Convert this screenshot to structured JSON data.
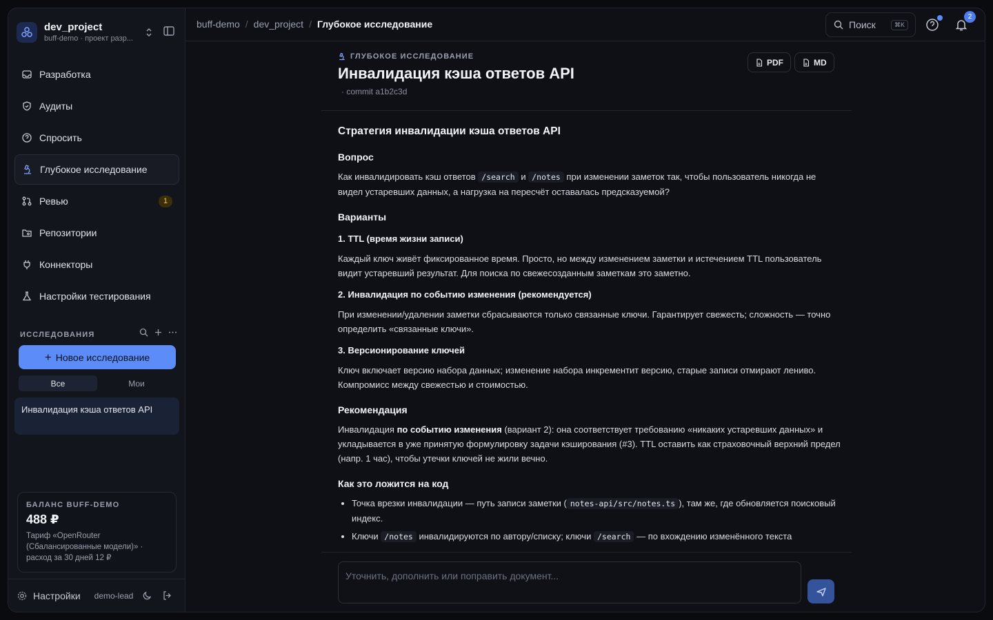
{
  "workspace": {
    "name": "dev_project",
    "subtitle": "buff-demo · проект разр..."
  },
  "nav": [
    {
      "label": "Разработка",
      "icon": "inbox-icon"
    },
    {
      "label": "Аудиты",
      "icon": "shield-icon"
    },
    {
      "label": "Спросить",
      "icon": "question-icon"
    },
    {
      "label": "Глубокое исследование",
      "icon": "microscope-icon",
      "active": true
    },
    {
      "label": "Ревью",
      "icon": "git-pull-request-icon",
      "badge": "1"
    },
    {
      "label": "Репозитории",
      "icon": "folder-git-icon"
    },
    {
      "label": "Коннекторы",
      "icon": "plug-icon"
    },
    {
      "label": "Настройки тестирования",
      "icon": "flask-icon"
    }
  ],
  "research": {
    "title": "ИССЛЕДОВАНИЯ",
    "new_label": "Новое исследование",
    "filters": [
      "Все",
      "Мои"
    ],
    "items": [
      "Инвалидация кэша ответов API"
    ]
  },
  "balance": {
    "title": "БАЛАНС BUFF-DEMO",
    "value": "488 ₽",
    "desc": "Тариф «OpenRouter (Сбалансированные модели)» · расход за 30 дней 12 ₽"
  },
  "footer": {
    "settings": "Настройки",
    "user": "demo-lead"
  },
  "breadcrumbs": [
    "buff-demo",
    "dev_project",
    "Глубокое исследование"
  ],
  "search": {
    "placeholder": "Поиск",
    "shortcut": "⌘K"
  },
  "notifications": {
    "count": "2"
  },
  "doc": {
    "kicker": "ГЛУБОКОЕ ИССЛЕДОВАНИЕ",
    "title": "Инвалидация кэша ответов API",
    "meta": "· commit a1b2c3d",
    "export_pdf": "PDF",
    "export_md": "MD",
    "h_strategy": "Стратегия инвалидации кэша ответов API",
    "h_question": "Вопрос",
    "q_1": "Как инвалидировать кэш ответов",
    "q_code1": "/search",
    "q_and": "и",
    "q_code2": "/notes",
    "q_2": "при изменении заметок так, чтобы пользователь никогда не видел устаревших данных, а нагрузка на пересчёт оставалась предсказуемой?",
    "h_options": "Варианты",
    "opt1_title": "1. TTL (время жизни записи)",
    "opt1_text": "Каждый ключ живёт фиксированное время. Просто, но между изменением заметки и истечением TTL пользователь видит устаревший результат. Для поиска по свежесозданным заметкам это заметно.",
    "opt2_title": "2. Инвалидация по событию изменения (рекомендуется)",
    "opt2_text": "При изменении/удалении заметки сбрасываются только связанные ключи. Гарантирует свежесть; сложность — точно определить «связанные ключи».",
    "opt3_title": "3. Версионирование ключей",
    "opt3_text": "Ключ включает версию набора данных; изменение набора инкрементит версию, старые записи отмирают лениво. Компромисс между свежестью и стоимостью.",
    "h_rec": "Рекомендация",
    "rec_1": "Инвалидация",
    "rec_bold": "по событию изменения",
    "rec_2": "(вариант 2): она соответствует требованию «никаких устаревших данных» и укладывается в уже принятую формулировку задачи кэширования (#3). TTL оставить как страховочный верхний предел (напр. 1 час), чтобы утечки ключей не жили вечно.",
    "h_code": "Как это ложится на код",
    "li1_1": "Точка врезки инвалидации — путь записи заметки (",
    "li1_code": "notes-api/src/notes.ts",
    "li1_2": "), там же, где обновляется поисковый индекс.",
    "li2_1": "Ключи",
    "li2_code1": "/notes",
    "li2_2": "инвалидируются по автору/списку; ключи",
    "li2_code2": "/search",
    "li2_3": "— по вхождению изменённого текста"
  },
  "composer": {
    "placeholder": "Уточнить, дополнить или поправить документ..."
  },
  "colors": {
    "accent": "#5b8cf7",
    "badge": "#f2c14e"
  }
}
